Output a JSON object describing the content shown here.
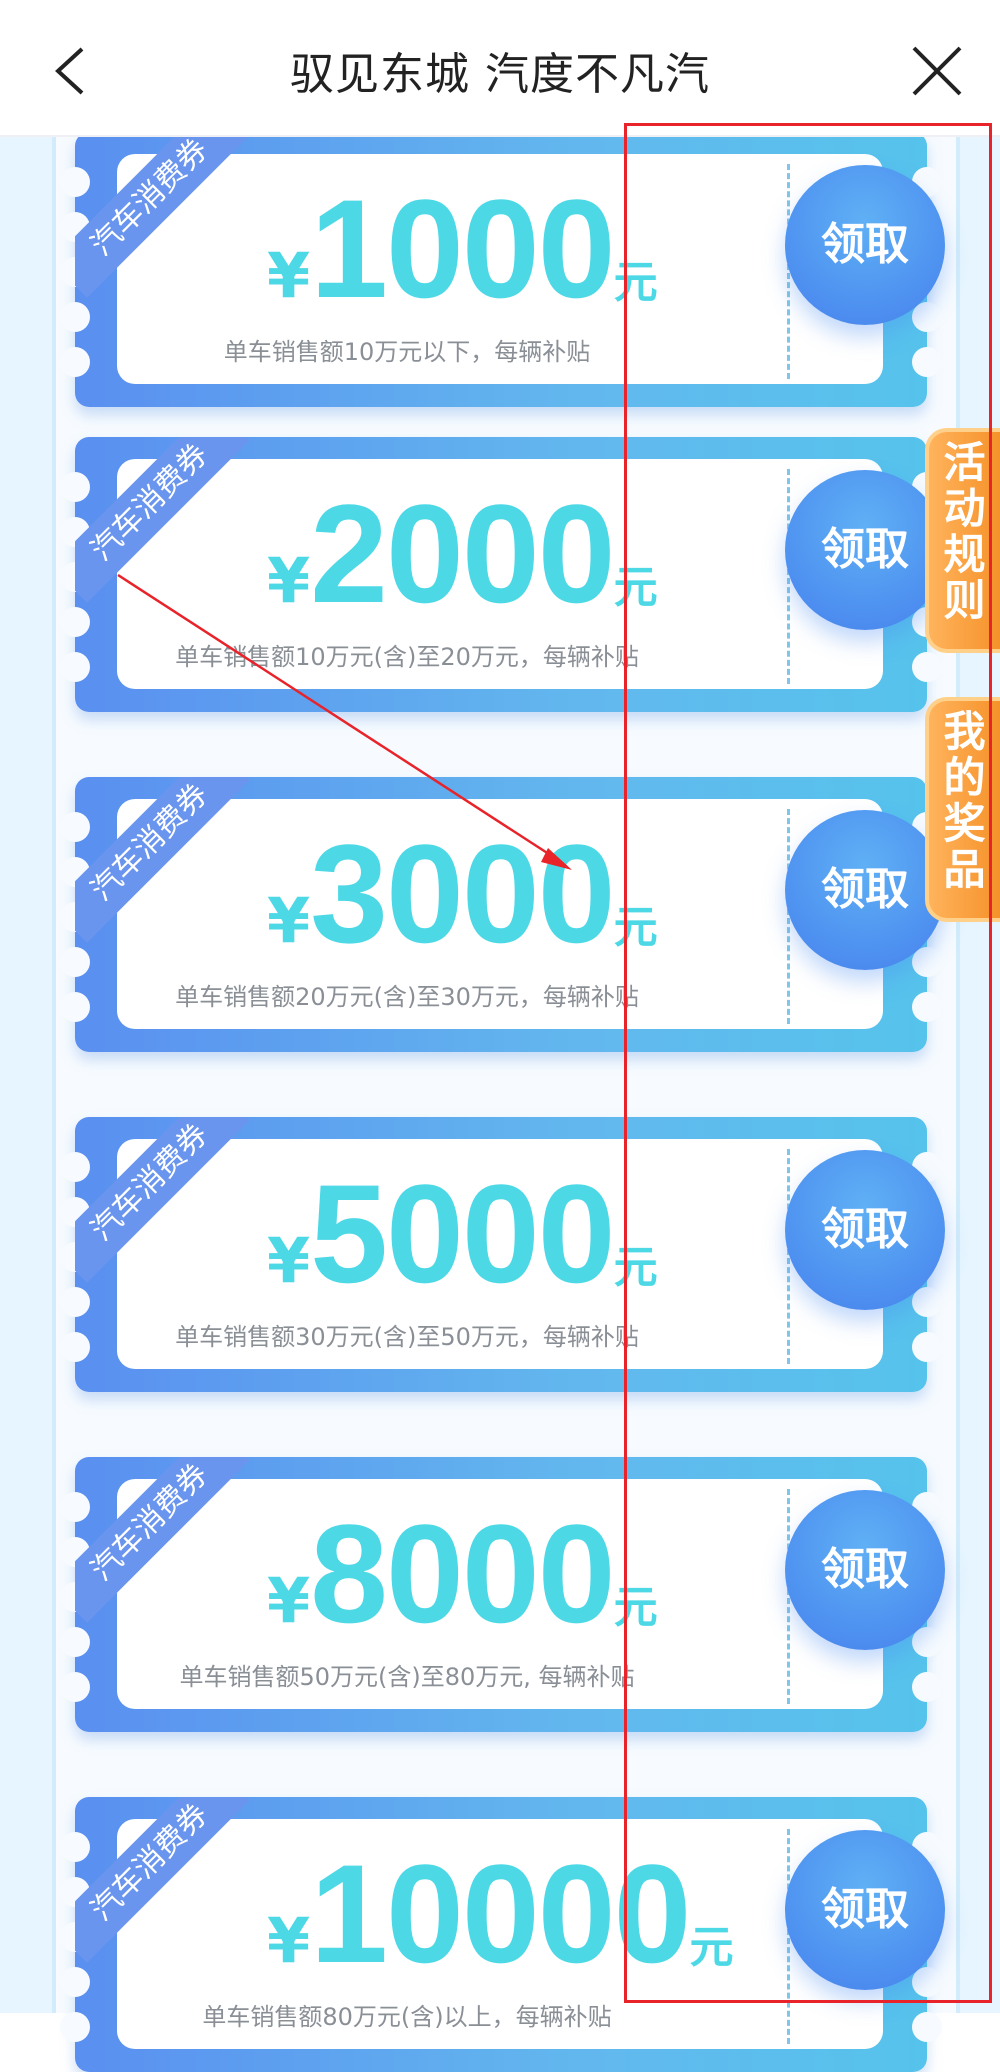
{
  "header": {
    "title": "驭见东城 汽度不凡汽",
    "back_icon": "chevron-left-icon",
    "close_icon": "close-icon"
  },
  "coupons": [
    {
      "ribbon": "汽车消费券",
      "yen": "¥",
      "amount": "1000",
      "unit": "元",
      "desc": "单车销售额10万元以下，每辆补贴",
      "button": "领取"
    },
    {
      "ribbon": "汽车消费券",
      "yen": "¥",
      "amount": "2000",
      "unit": "元",
      "desc": "单车销售额10万元(含)至20万元，每辆补贴",
      "button": "领取"
    },
    {
      "ribbon": "汽车消费券",
      "yen": "¥",
      "amount": "3000",
      "unit": "元",
      "desc": "单车销售额20万元(含)至30万元，每辆补贴",
      "button": "领取"
    },
    {
      "ribbon": "汽车消费券",
      "yen": "¥",
      "amount": "5000",
      "unit": "元",
      "desc": "单车销售额30万元(含)至50万元，每辆补贴",
      "button": "领取"
    },
    {
      "ribbon": "汽车消费券",
      "yen": "¥",
      "amount": "8000",
      "unit": "元",
      "desc": "单车销售额50万元(含)至80万元, 每辆补贴",
      "button": "领取"
    },
    {
      "ribbon": "汽车消费券",
      "yen": "¥",
      "amount": "10000",
      "unit": "元",
      "desc": "单车销售额80万元(含)以上，每辆补贴",
      "button": "领取"
    }
  ],
  "side_tabs": {
    "rules": "活动规则",
    "prizes": "我的奖品"
  },
  "colors": {
    "accent": "#4dd8e6",
    "button": "#4d8ff0",
    "side_tab": "#f5922a",
    "annotation": "#e8232a"
  }
}
